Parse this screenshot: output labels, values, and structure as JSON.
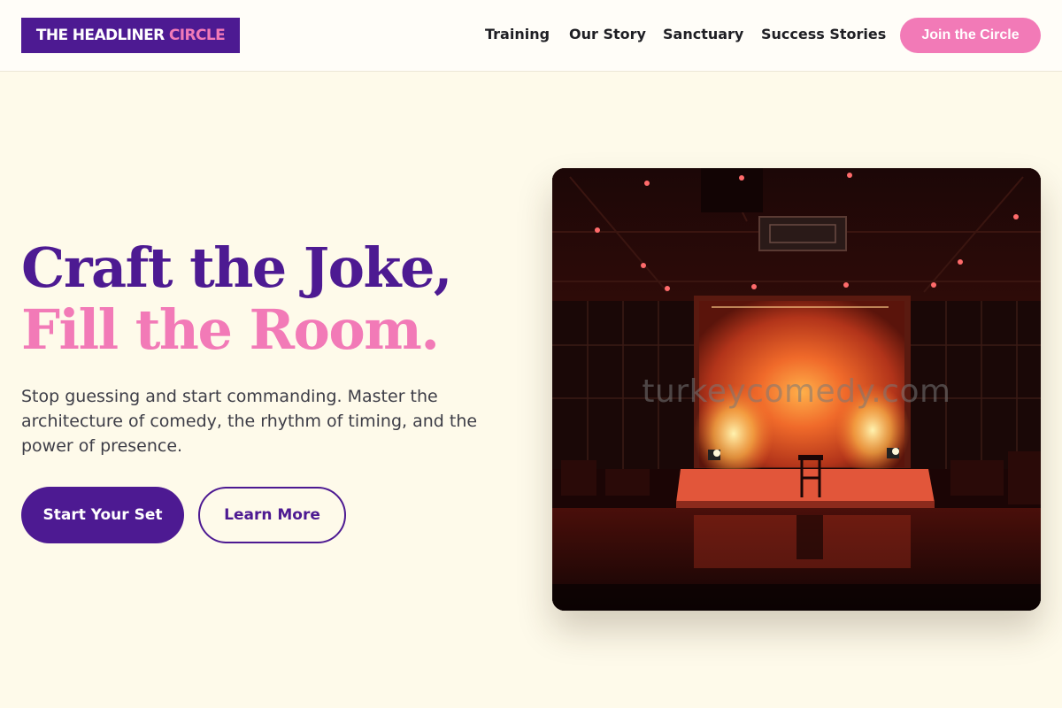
{
  "header": {
    "logo": {
      "main": "THE HEADLINER ",
      "accent": "CIRCLE"
    },
    "nav": [
      "Training",
      "Our Story",
      "Sanctuary",
      "Success Stories"
    ],
    "cta_label": "Join the Circle"
  },
  "hero": {
    "title_line1": "Craft the Joke,",
    "title_line2": "Fill the Room.",
    "subtitle": "Stop guessing and start commanding. Master the architecture of comedy, the rhythm of timing, and the power of presence.",
    "primary_button": "Start Your Set",
    "secondary_button": "Learn More"
  },
  "photo": {
    "watermark": "turkeycomedy.com"
  },
  "colors": {
    "brand_purple": "#4d1a92",
    "brand_pink": "#f27ab7",
    "background": "#fefaea"
  }
}
